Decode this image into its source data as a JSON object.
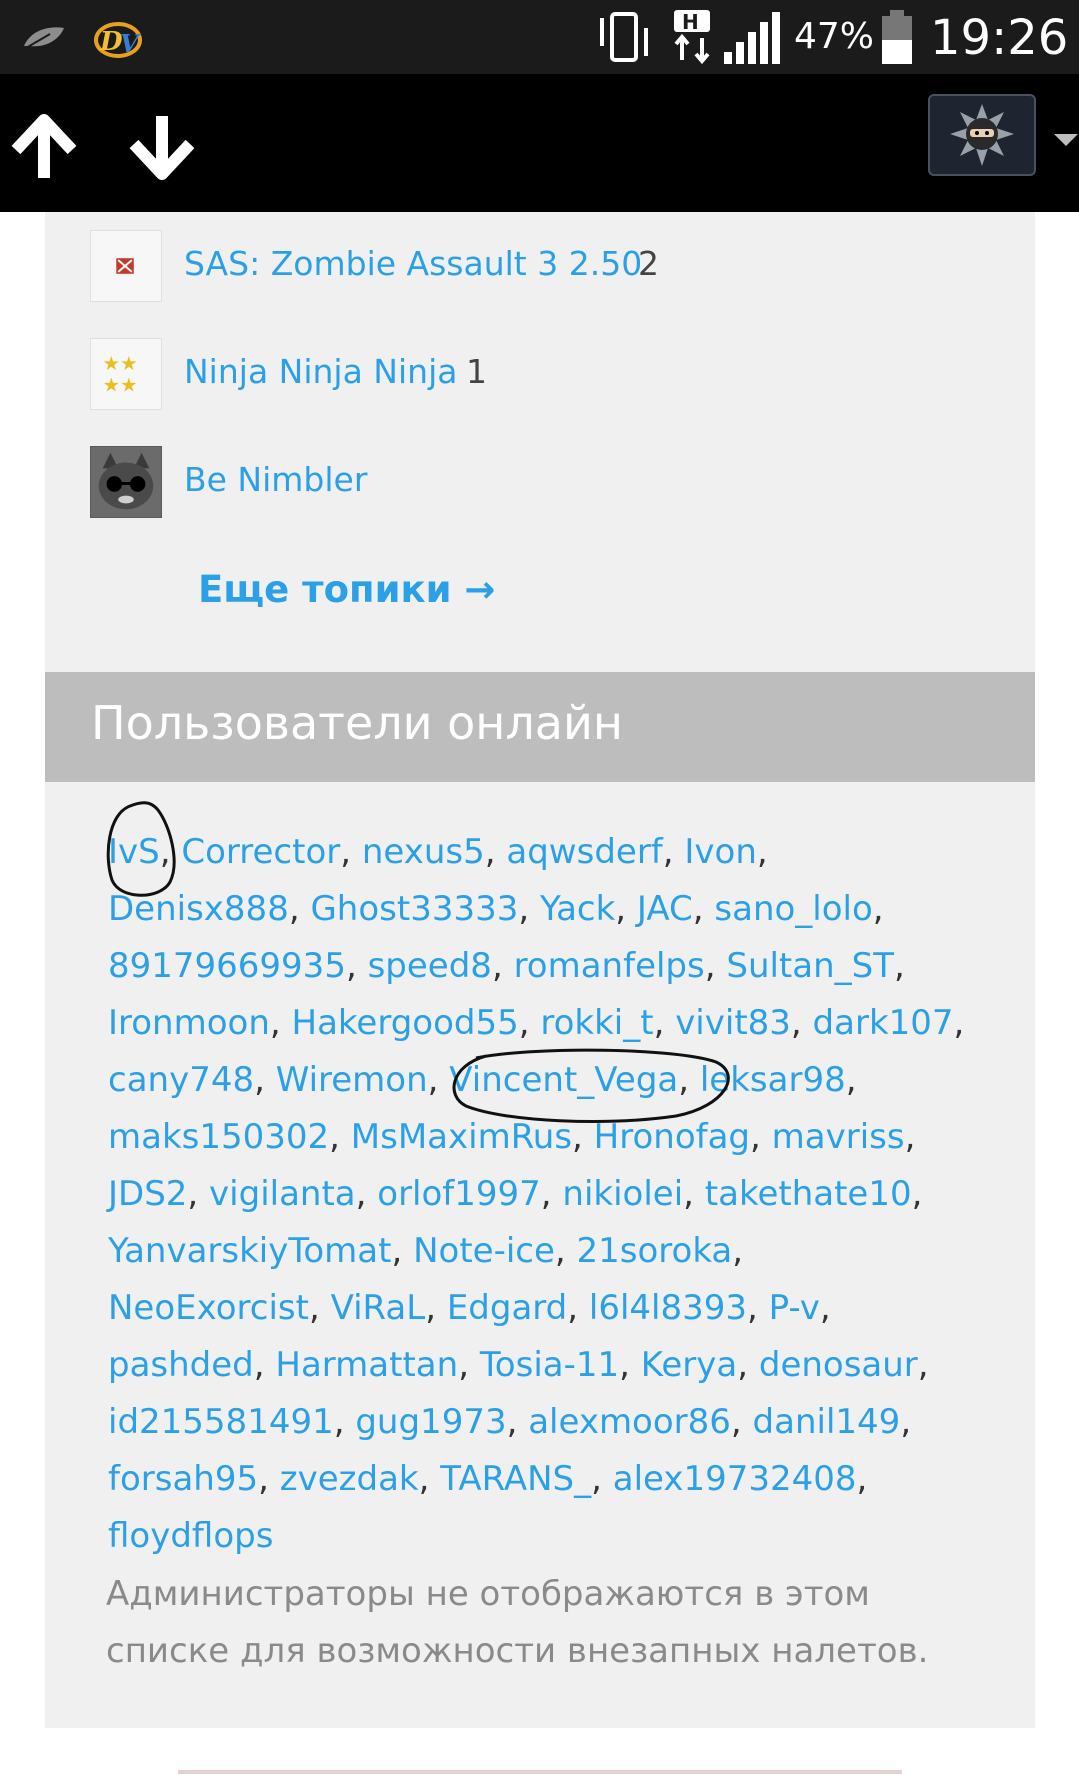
{
  "status_bar": {
    "battery_percent": "47%",
    "time": "19:26",
    "network": "H",
    "icons": [
      "leaf-icon",
      "dv-app-icon",
      "vibrate-icon",
      "hplus-data-icon",
      "signal-icon",
      "battery-icon"
    ]
  },
  "toolbar": {
    "icons": [
      "arrow-up-icon",
      "arrow-down-icon",
      "ninja-avatar-icon",
      "dropdown-caret-icon"
    ]
  },
  "topics": [
    {
      "title": "SAS: Zombie Assault 3 2.50",
      "count": "2",
      "thumb": "dota-logo-icon"
    },
    {
      "title": "Ninja Ninja Ninja",
      "count": "1",
      "thumb": "stars-icon"
    },
    {
      "title": "Be Nimbler",
      "count": "",
      "thumb": "cat-avatar-icon"
    }
  ],
  "more_topics": "Еще топики →",
  "online_section": {
    "title": "Пользователи онлайн",
    "user_lines": [
      [
        "IvS",
        "Corrector",
        "nexus5",
        "aqwsderf",
        "Ivon"
      ],
      [
        "Denisx888",
        "Ghost33333",
        "Yack",
        "JAC",
        "sano_lolo"
      ],
      [
        "89179669935",
        "speed8",
        "romanfelps",
        "Sultan_ST"
      ],
      [
        "Ironmoon",
        "Hakergood55",
        "rokki_t",
        "vivit83",
        "dark107"
      ],
      [
        "cany748",
        "Wiremon",
        "Vincent_Vega",
        "leksar98"
      ],
      [
        "maks150302",
        "MsMaximRus",
        "Hronofag",
        "mavriss"
      ],
      [
        "JDS2",
        "vigilanta",
        "orlof1997",
        "nikiolei",
        "takethate10"
      ],
      [
        "YanvarskiyTomat",
        "Note-ice",
        "21soroka"
      ],
      [
        "NeoExorcist",
        "ViRaL",
        "Edgard",
        "l6l4l8393",
        "P-v"
      ],
      [
        "pashded",
        "Harmattan",
        "Tosia-11",
        "Kerya",
        "denosaur"
      ],
      [
        "id215581491",
        "gug1973",
        "alexmoor86",
        "danil149"
      ],
      [
        "forsah95",
        "zvezdak",
        "TARANS_",
        "alex19732408"
      ],
      [
        "floydflops"
      ]
    ],
    "note_lines": [
      "Администраторы не отображаются в этом",
      "списке для возможности внезапных налетов."
    ]
  },
  "colors": {
    "link": "#2ba0e6",
    "header_bg": "#bdbdbd",
    "panel_bg": "#f0f0f0",
    "toolbar_bg": "#000000",
    "note": "#8a8a8a"
  }
}
